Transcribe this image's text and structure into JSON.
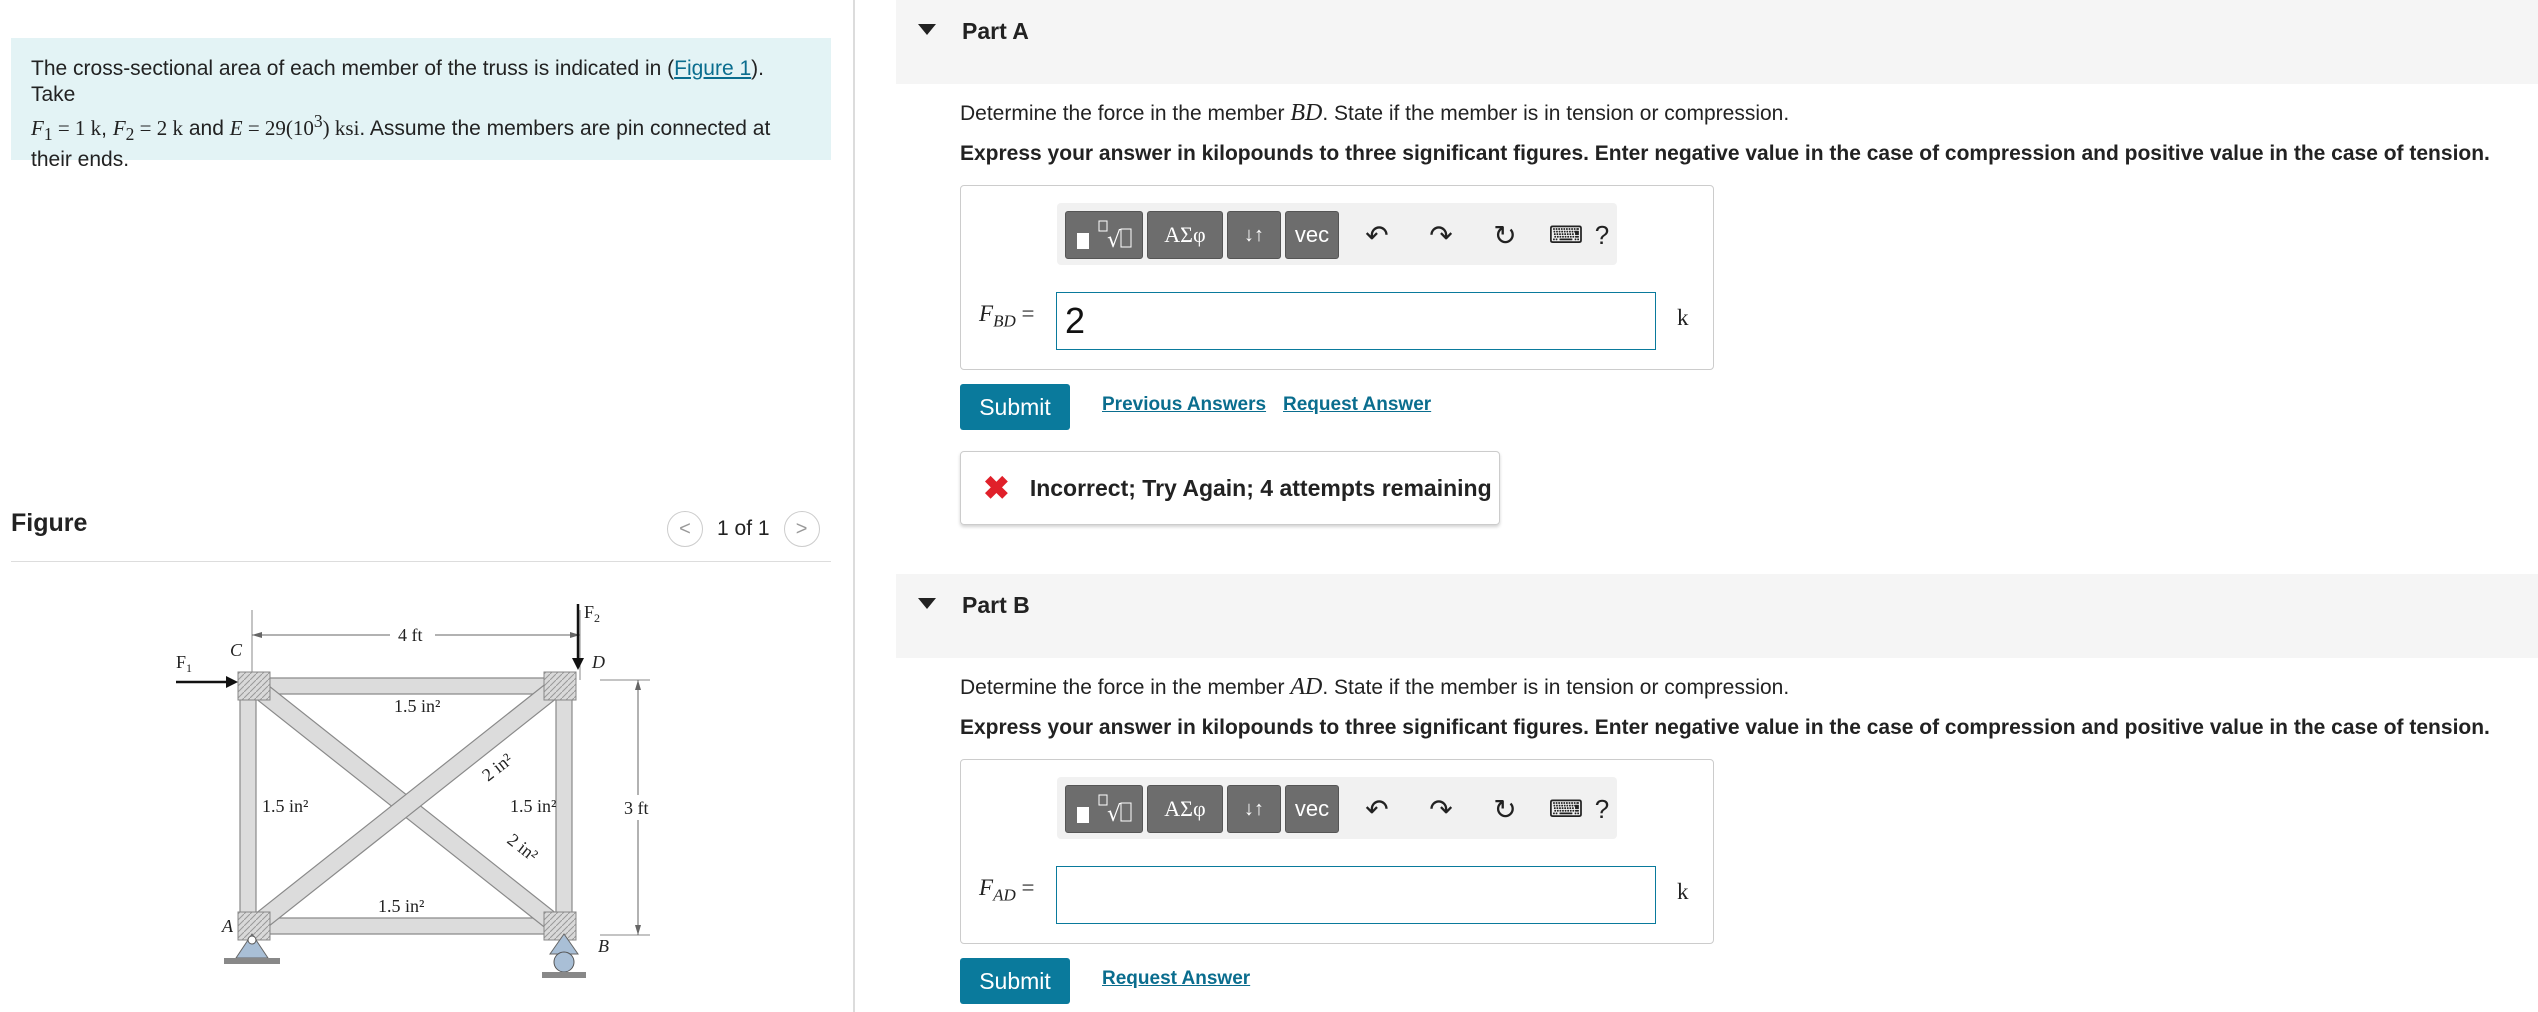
{
  "problem": {
    "text_a": "The cross-sectional area of each member of the truss is indicated in (",
    "figure_link": "Figure 1",
    "text_b": "). Take",
    "f1": "F",
    "f1_sub": "1",
    "f1_eq": " = 1 k",
    "sep1": ", ",
    "f2": "F",
    "f2_sub": "2",
    "f2_eq": " = 2 k",
    "and": " and ",
    "e": "E",
    "e_eq": " = 29(10",
    "e_sup": "3",
    "e_unit": ") ksi",
    "text_c": ". Assume the members are pin connected at their ends."
  },
  "figure": {
    "title": "Figure",
    "pager": "1 of 1",
    "prev_glyph": "<",
    "next_glyph": ">",
    "labels": {
      "f1": "F",
      "f1_sub": "1",
      "f2": "F",
      "f2_sub": "2",
      "c": "C",
      "d": "D",
      "a": "A",
      "b": "B",
      "top_dim": "4 ft",
      "right_dim": "3 ft",
      "top_area": "1.5 in²",
      "left_area": "1.5 in²",
      "right_area": "1.5 in²",
      "bottom_area": "1.5 in²",
      "diag1_area": "2 in²",
      "diag2_area": "2 in²"
    }
  },
  "parts": [
    {
      "title": "Part A",
      "question_a": "Determine the force in the member ",
      "member": "BD",
      "question_b": ". State if the member is in tension or compression.",
      "instruction": "Express your answer in kilopounds to three significant figures. Enter negative value in the case of compression and positive value in the case of tension.",
      "var": "F",
      "var_sub": "BD",
      "equals": " =",
      "value": "2",
      "unit": "k",
      "submit": "Submit",
      "links": [
        "Previous Answers",
        "Request Answer"
      ],
      "feedback_icon": "✖",
      "feedback": "Incorrect; Try Again; 4 attempts remaining"
    },
    {
      "title": "Part B",
      "question_a": "Determine the force in the member ",
      "member": "AD",
      "question_b": ". State if the member is in tension or compression.",
      "instruction": "Express your answer in kilopounds to three significant figures. Enter negative value in the case of compression and positive value in the case of tension.",
      "var": "F",
      "var_sub": "AD",
      "equals": " =",
      "value": "",
      "unit": "k",
      "submit": "Submit",
      "links": [
        "Request Answer"
      ]
    }
  ],
  "toolbar": {
    "greek": "ΑΣφ",
    "vec": "vec",
    "help": "?"
  }
}
